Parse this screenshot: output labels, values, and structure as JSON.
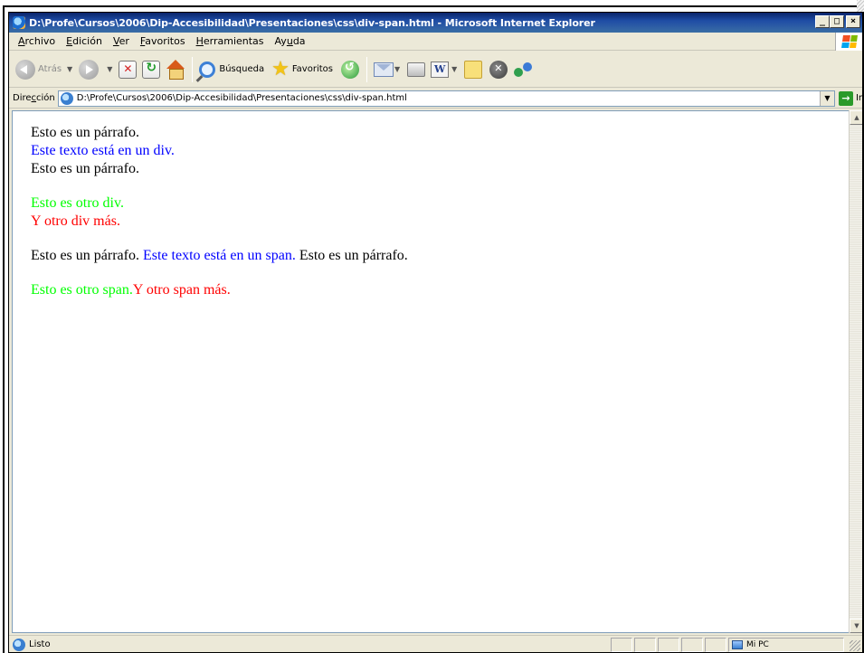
{
  "window": {
    "title": "D:\\Profe\\Cursos\\2006\\Dip-Accesibilidad\\Presentaciones\\css\\div-span.html - Microsoft Internet Explorer",
    "btn_min": "_",
    "btn_max": "□",
    "btn_close": "×"
  },
  "menu": {
    "items": [
      {
        "acc": "A",
        "rest": "rchivo"
      },
      {
        "acc": "E",
        "rest": "dición"
      },
      {
        "acc": "V",
        "rest": "er"
      },
      {
        "acc": "F",
        "rest": "avoritos"
      },
      {
        "acc": "H",
        "rest": "erramientas"
      },
      {
        "pre": "Ay",
        "acc": "u",
        "rest": "da"
      }
    ]
  },
  "toolbar": {
    "back_label": "Atrás",
    "search_label": "Búsqueda",
    "favorites_label": "Favoritos"
  },
  "address": {
    "label_pre": "Dire",
    "label_acc": "c",
    "label_rest": "ción",
    "url": "D:\\Profe\\Cursos\\2006\\Dip-Accesibilidad\\Presentaciones\\css\\div-span.html",
    "go_label": "Ir"
  },
  "content": {
    "p1": "Esto es un párrafo.",
    "div1": "Este texto está en un div.",
    "p2": "Esto es un párrafo.",
    "div2": "Esto es otro div.",
    "div3": "Y otro div más.",
    "line3_a": "Esto es un párrafo.",
    "line3_span": "Este texto está en un span.",
    "line3_b": "Esto es un párrafo.",
    "span2": "Esto es otro span.",
    "span3": "Y otro span más."
  },
  "colors": {
    "blue": "#0000ff",
    "green": "#00ff00",
    "red": "#ff0000"
  },
  "status": {
    "text": "Listo",
    "zone": "Mi PC"
  }
}
